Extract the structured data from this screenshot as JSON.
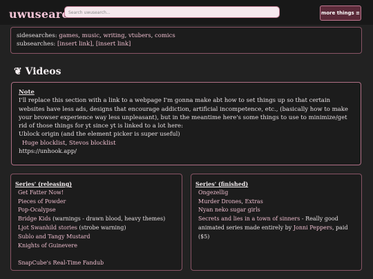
{
  "header": {
    "logo": "uwusearch",
    "search_placeholder": "Search uwusearch...",
    "more_button": "more things ≡"
  },
  "side": {
    "sidesearches_label": "sidesearches: ",
    "sidesearches": [
      "games",
      "music",
      "writing",
      "vtubers",
      "comics"
    ],
    "subsearches_label": "subsearches: ",
    "subsearches": [
      "[insert link]",
      "[insert link]"
    ]
  },
  "videos": {
    "icon": "❦",
    "title": "Videos"
  },
  "note": {
    "title": "Note",
    "body": "I'll replace this section with a link to a webpage I'm gonna make abt how to set things up so that certain websites have less ads, designs that encourage addiction, artificial incompetence, etc., (basically how to make your browser experience way less unpleasant), but in the meantime here's some things to use to minimize/get rid of those things for yt since yt is linked to a lot here:",
    "line2": "Ublock origin (and the element picker is super useful)",
    "link1": "Huge blocklist",
    "link2": "Stevos blocklist",
    "line4": "https://unhook.app/"
  },
  "releasing": {
    "title": "Series' (releasing)",
    "items": [
      {
        "link": "Get Fatter Now!",
        "extra": ""
      },
      {
        "link": "Pieces of Powder",
        "extra": ""
      },
      {
        "link": "Pop-Ocalypse",
        "extra": ""
      },
      {
        "link": "Bridge Kids",
        "extra": " (warnings - drawn blood, heavy themes)"
      },
      {
        "link": "Ljot Swanhild stories",
        "extra": " (strobe warning)"
      },
      {
        "link": "Sublo and Tangy Mustard",
        "extra": ""
      },
      {
        "link": "Knights of Guinevere",
        "extra": ""
      }
    ],
    "footer": "SnapCube's Real-Time Fandub"
  },
  "finished": {
    "title": "Series' (finished)",
    "items": [
      {
        "link": "Ongezellig",
        "extra": ""
      },
      {
        "link": "Murder Drones",
        "extra": ", "
      },
      {
        "link": "Extras",
        "extra": ""
      },
      {
        "link": "Nyan neko sugar girls",
        "extra": ""
      }
    ],
    "last_link": "Secrets and lies in a town of sinners",
    "last_text": " - Really good animated series made entirely by ",
    "last_author": "Jonni Peppers",
    "last_tail": ", paid ($5)"
  }
}
